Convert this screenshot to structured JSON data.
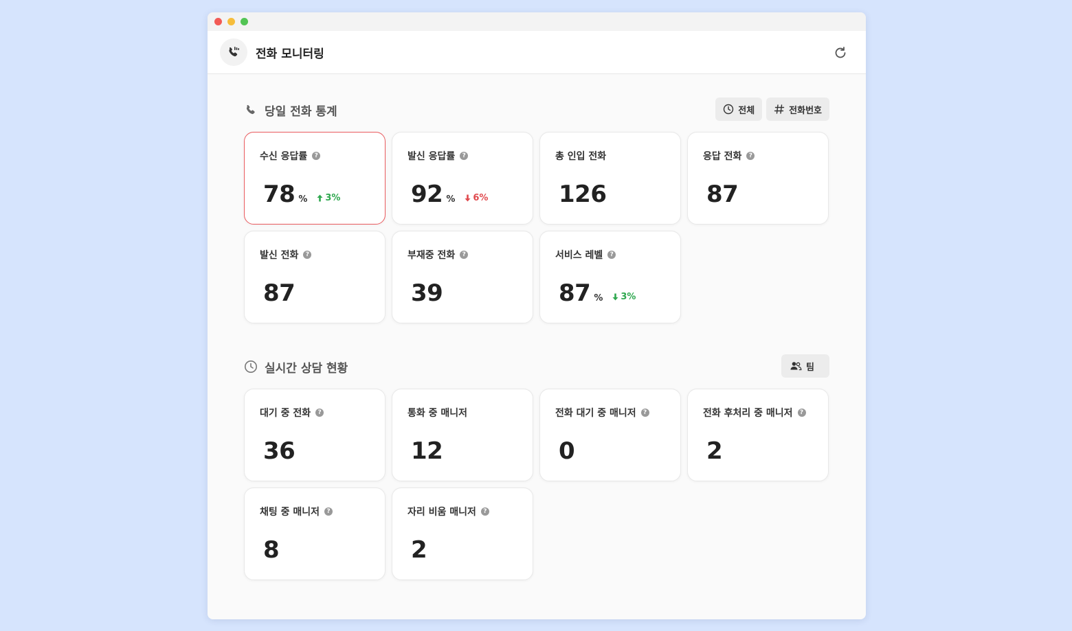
{
  "window": {
    "title": "전화 모니터링"
  },
  "stats_section": {
    "title": "당일 전화 통계",
    "filter_all_label": "전체",
    "filter_number_label": "전화번호",
    "cards": [
      {
        "label": "수신 응답률",
        "value": "78",
        "unit": "%",
        "trend": "3%",
        "trend_dir": "up",
        "help": true,
        "active": true
      },
      {
        "label": "발신 응답률",
        "value": "92",
        "unit": "%",
        "trend": "6%",
        "trend_dir": "down",
        "help": true
      },
      {
        "label": "총 인입 전화",
        "value": "126",
        "help": false
      },
      {
        "label": "응답 전화",
        "value": "87",
        "help": true
      },
      {
        "label": "발신 전화",
        "value": "87",
        "help": true
      },
      {
        "label": "부재중 전화",
        "value": "39",
        "help": true
      },
      {
        "label": "서비스 레벨",
        "value": "87",
        "unit": "%",
        "trend": "3%",
        "trend_dir": "down",
        "help": true
      }
    ]
  },
  "realtime_section": {
    "title": "실시간 상담 현황",
    "team_label": "팀",
    "cards": [
      {
        "label": "대기 중 전화",
        "value": "36",
        "help": true
      },
      {
        "label": "통화 중 매니저",
        "value": "12",
        "help": false
      },
      {
        "label": "전화 대기 중 매니저",
        "value": "0",
        "help": true
      },
      {
        "label": "전화 후처리 중 매니저",
        "value": "2",
        "help": true
      },
      {
        "label": "채팅 중 매니저",
        "value": "8",
        "help": true
      },
      {
        "label": "자리 비움 매니저",
        "value": "2",
        "help": true
      }
    ]
  },
  "colors": {
    "accent_active_border": "#ea5a5e",
    "trend_up": "#2fa84f",
    "trend_down": "#e04a4e",
    "background": "#d6e4fd"
  },
  "icons": {
    "app": "phone-signal-icon",
    "refresh": "refresh-icon",
    "stats": "phone-icon",
    "realtime": "clock-icon",
    "all": "clock-icon",
    "number": "hash-icon",
    "team": "users-icon"
  }
}
